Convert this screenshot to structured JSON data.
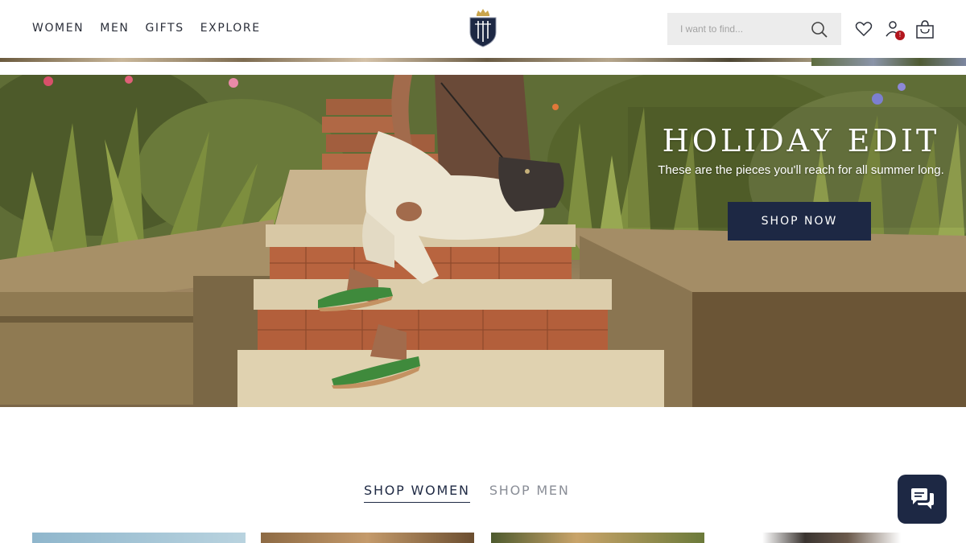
{
  "nav": {
    "items": [
      "WOMEN",
      "MEN",
      "GIFTS",
      "EXPLORE"
    ]
  },
  "brand": {
    "logo_icon": "crest-logo-icon",
    "primary_color": "#1d2844"
  },
  "search": {
    "placeholder": "I want to find...",
    "value": ""
  },
  "header_icons": {
    "wishlist": "heart-icon",
    "account": "user-icon",
    "account_badge": "!",
    "bag": "shopping-bag-icon"
  },
  "hero": {
    "title": "HOLIDAY EDIT",
    "subtitle": "These are the pieces you'll reach for all summer long.",
    "cta_label": "SHOP NOW"
  },
  "tabs": [
    {
      "label": "SHOP WOMEN",
      "active": true
    },
    {
      "label": "SHOP MEN",
      "active": false
    }
  ],
  "chat": {
    "icon": "chat-bubbles-icon"
  }
}
